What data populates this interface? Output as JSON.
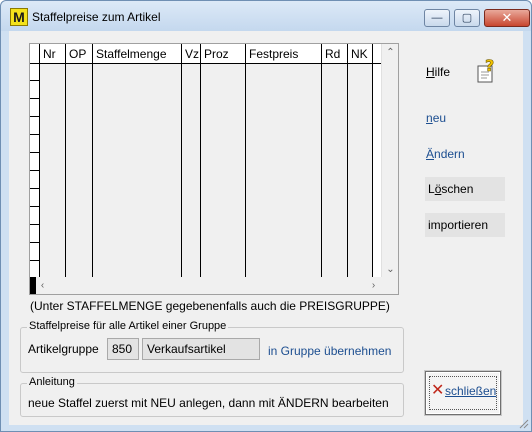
{
  "window": {
    "title": "Staffelpreise zum Artikel",
    "app_icon": "M",
    "controls": {
      "minimize": "—",
      "maximize": "▢",
      "close": "✕"
    }
  },
  "grid": {
    "columns": [
      "Nr",
      "OP",
      "Staffelmenge",
      "Vz",
      "Proz",
      "Festpreis",
      "Rd",
      "NK"
    ],
    "rows": []
  },
  "note": "(Unter STAFFELMENGE gegebenenfalls auch die PREISGRUPPE)",
  "group_section": {
    "legend": "Staffelpreise für alle Artikel einer Gruppe",
    "label": "Artikelgruppe",
    "group_number": "850",
    "group_name": "Verkaufsartikel",
    "apply_link": "in Gruppe übernehmen"
  },
  "instructions": {
    "legend": "Anleitung",
    "text": "neue Staffel zuerst mit NEU anlegen, dann mit ÄNDERN bearbeiten"
  },
  "sidebar": {
    "help_prefix": "H",
    "help_rest": "ilfe",
    "new_prefix": "n",
    "new_rest": "eu",
    "change_prefix": "Ä",
    "change_rest": "ndern",
    "delete_pre": "L",
    "delete_u": "ö",
    "delete_post": "schen",
    "import_label": "importieren",
    "close_pre": "s",
    "close_u": "c",
    "close_post": "hließen"
  },
  "icons": {
    "help": "help-question-icon",
    "close": "close-x-icon"
  },
  "colors": {
    "link": "#1c4e90",
    "close_x": "#c0281b"
  }
}
